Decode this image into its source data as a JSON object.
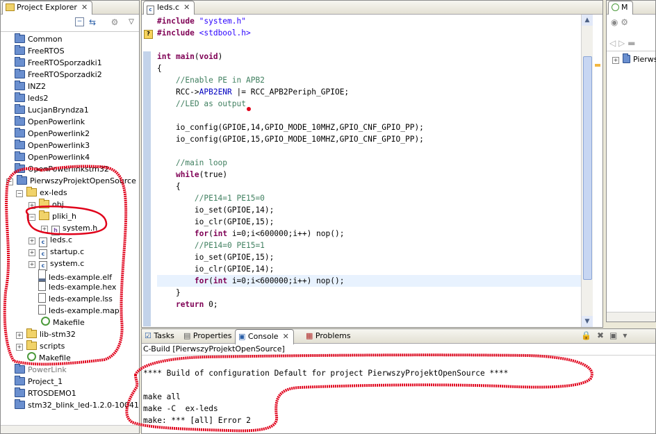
{
  "project_explorer": {
    "tab_title": "Project Explorer",
    "items_top": [
      "Common",
      "FreeRTOS",
      "FreeRTOSporzadki1",
      "FreeRTOSporzadki2",
      "INZ2",
      "leds2",
      "LucjanBryndza1",
      "OpenPowerlink",
      "OpenPowerlink2",
      "OpenPowerlink3",
      "OpenPowerlink4",
      "OpenPowerlinkstm32",
      "PierwszyProjektOpenSource"
    ],
    "ex_leds": "ex-leds",
    "obj": "obj",
    "pliki_h": "pliki_h",
    "system_h": "system.h",
    "files": [
      "leds.c",
      "startup.c",
      "system.c",
      "leds-example.elf",
      "leds-example.hex",
      "leds-example.lss",
      "leds-example.map",
      "Makefile"
    ],
    "lib_stm32": "lib-stm32",
    "scripts": "scripts",
    "makefile_root": "Makefile",
    "items_bottom": [
      "Project_1",
      "RTOSDEMO1",
      "stm32_blink_led-1.2.0-10041"
    ],
    "hidden_item": "PowerLink"
  },
  "editor": {
    "tab_title": "leds.c",
    "lines": [
      {
        "parts": [
          {
            "t": "#include ",
            "c": "kw"
          },
          {
            "t": "\"system.h\"",
            "c": "str"
          }
        ]
      },
      {
        "parts": [
          {
            "t": "#include ",
            "c": "kw"
          },
          {
            "t": "<stdbool.h>",
            "c": "str"
          }
        ]
      },
      {
        "parts": []
      },
      {
        "parts": [
          {
            "t": "int",
            "c": "kw"
          },
          {
            "t": " main",
            "c": "kw"
          },
          {
            "t": "(",
            "c": ""
          },
          {
            "t": "void",
            "c": "kw"
          },
          {
            "t": ")",
            "c": ""
          }
        ]
      },
      {
        "parts": [
          {
            "t": "{",
            "c": ""
          }
        ]
      },
      {
        "parts": [
          {
            "t": "    //Enable PE in APB2",
            "c": "cm"
          }
        ]
      },
      {
        "parts": [
          {
            "t": "    RCC->",
            "c": ""
          },
          {
            "t": "APB2ENR",
            "c": "mac"
          },
          {
            "t": " |= RCC_APB2Periph_GPIOE;",
            "c": ""
          }
        ]
      },
      {
        "parts": [
          {
            "t": "    //LED as output",
            "c": "cm"
          }
        ]
      },
      {
        "parts": []
      },
      {
        "parts": [
          {
            "t": "    io_config(GPIOE,14,GPIO_MODE_10MHZ,GPIO_CNF_GPIO_PP);",
            "c": ""
          }
        ]
      },
      {
        "parts": [
          {
            "t": "    io_config(GPIOE,15,GPIO_MODE_10MHZ,GPIO_CNF_GPIO_PP);",
            "c": ""
          }
        ]
      },
      {
        "parts": []
      },
      {
        "parts": [
          {
            "t": "    //main loop",
            "c": "cm"
          }
        ]
      },
      {
        "parts": [
          {
            "t": "    ",
            "c": ""
          },
          {
            "t": "while",
            "c": "kw"
          },
          {
            "t": "(true)",
            "c": ""
          }
        ]
      },
      {
        "parts": [
          {
            "t": "    {",
            "c": ""
          }
        ]
      },
      {
        "parts": [
          {
            "t": "        //PE14=1 PE15=0",
            "c": "cm"
          }
        ]
      },
      {
        "parts": [
          {
            "t": "        io_set(GPIOE,14);",
            "c": ""
          }
        ]
      },
      {
        "parts": [
          {
            "t": "        io_clr(GPIOE,15);",
            "c": ""
          }
        ]
      },
      {
        "parts": [
          {
            "t": "        ",
            "c": ""
          },
          {
            "t": "for",
            "c": "kw"
          },
          {
            "t": "(",
            "c": ""
          },
          {
            "t": "int",
            "c": "kw"
          },
          {
            "t": " i=0;i<600000;i++) nop();",
            "c": ""
          }
        ]
      },
      {
        "parts": [
          {
            "t": "        //PE14=0 PE15=1",
            "c": "cm"
          }
        ]
      },
      {
        "parts": [
          {
            "t": "        io_set(GPIOE,15);",
            "c": ""
          }
        ]
      },
      {
        "parts": [
          {
            "t": "        io_clr(GPIOE,14);",
            "c": ""
          }
        ]
      },
      {
        "parts": [
          {
            "t": "        ",
            "c": ""
          },
          {
            "t": "for",
            "c": "kw"
          },
          {
            "t": "(",
            "c": ""
          },
          {
            "t": "int",
            "c": "kw"
          },
          {
            "t": " i=0;i<600000;i++) nop();",
            "c": ""
          }
        ]
      },
      {
        "parts": [
          {
            "t": "    }",
            "c": ""
          }
        ]
      },
      {
        "parts": [
          {
            "t": "    ",
            "c": ""
          },
          {
            "t": "return",
            "c": "kw"
          },
          {
            "t": " 0;",
            "c": ""
          }
        ]
      }
    ],
    "highlighted_line": 22
  },
  "outline": {
    "tab_title": "M",
    "item": "Pierws"
  },
  "console": {
    "tabs": [
      "Tasks",
      "Properties",
      "Console",
      "Problems"
    ],
    "title": "C-Build [PierwszyProjektOpenSource]",
    "lines": [
      "**** Build of configuration Default for project PierwszyProjektOpenSource ****",
      "",
      "make all",
      "make -C  ex-leds",
      "make: *** [all] Error 2"
    ]
  },
  "colors": {
    "keyword": "#7f0055",
    "string": "#2a00ff",
    "comment": "#3f7f5f",
    "annotation_red": "#e0001a"
  }
}
